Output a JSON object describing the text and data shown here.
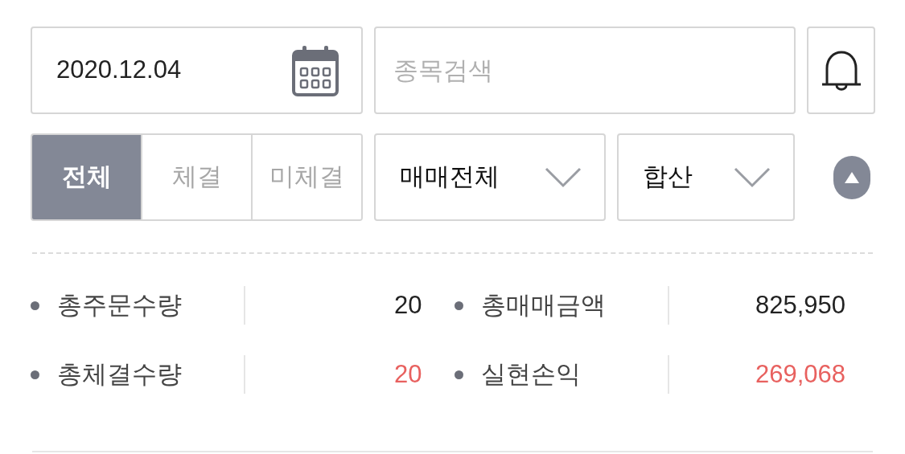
{
  "date_field": {
    "value": "2020.12.04"
  },
  "search": {
    "placeholder": "종목검색"
  },
  "filter_tabs": [
    {
      "label": "전체",
      "selected": true
    },
    {
      "label": "체결",
      "selected": false
    },
    {
      "label": "미체결",
      "selected": false
    }
  ],
  "dropdowns": [
    {
      "value": "매매전체"
    },
    {
      "value": "합산"
    }
  ],
  "summary": [
    {
      "label": "총주문수량",
      "value": "20",
      "color": "#222222"
    },
    {
      "label": "총매매금액",
      "value": "825,950",
      "color": "#222222"
    },
    {
      "label": "총체결수량",
      "value": "20",
      "color": "#e8615f"
    },
    {
      "label": "실현손익",
      "value": "269,068",
      "color": "#e8615f"
    }
  ]
}
